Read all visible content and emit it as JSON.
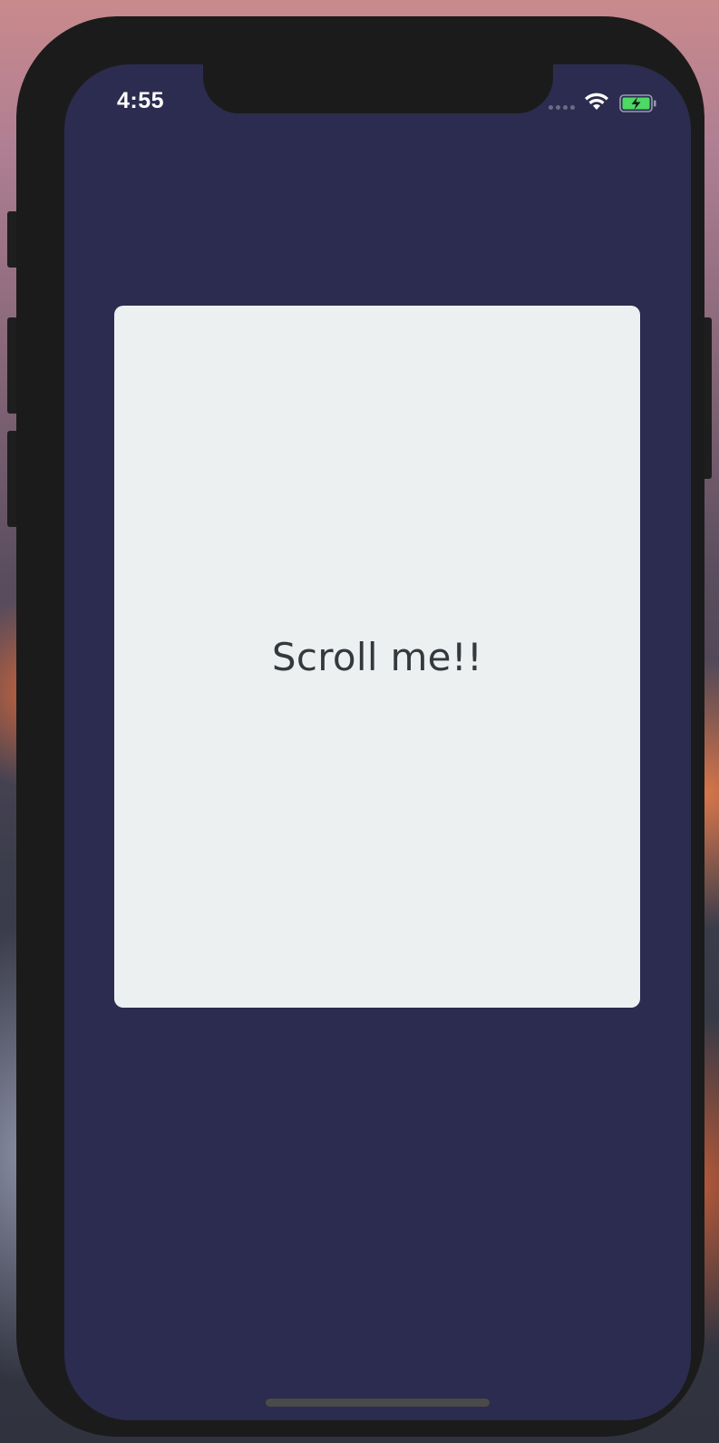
{
  "status_bar": {
    "time": "4:55",
    "icons": [
      "cellular-signal-icon",
      "wifi-icon",
      "battery-charging-icon"
    ],
    "battery_color": "#4cd964"
  },
  "main": {
    "card_text": "Scroll me!!"
  },
  "colors": {
    "screen_background": "#2c2c50",
    "card_background": "#ecf0f1",
    "card_text": "#34393d",
    "device_frame": "#1b1b1b"
  }
}
